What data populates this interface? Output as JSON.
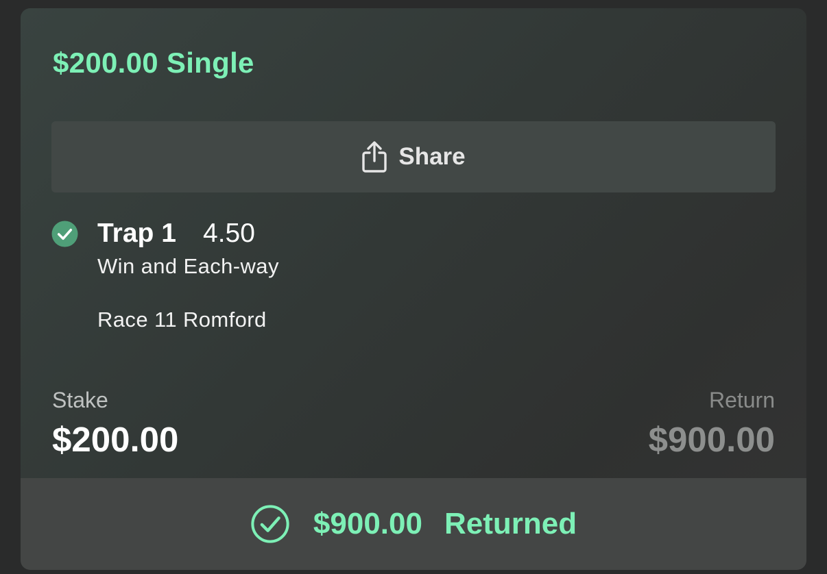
{
  "bet": {
    "title": "$200.00 Single"
  },
  "share": {
    "label": "Share",
    "icon": "share-icon"
  },
  "selection": {
    "status_icon": "check-circle-icon",
    "name": "Trap 1",
    "odds": "4.50",
    "market": "Win and Each-way",
    "event": "Race 11 Romford"
  },
  "summary": {
    "stake_label": "Stake",
    "stake_value": "$200.00",
    "return_label": "Return",
    "return_value": "$900.00"
  },
  "result": {
    "icon": "check-circle-outline-icon",
    "amount": "$900.00",
    "status": "Returned"
  },
  "colors": {
    "accent": "#7df0b6",
    "badge": "#4f9f78"
  }
}
